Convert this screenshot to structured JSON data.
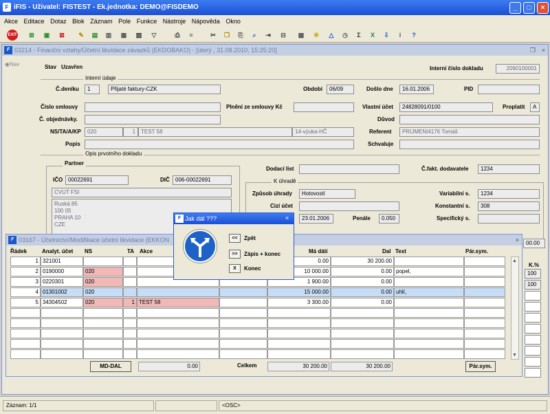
{
  "app": {
    "title": "iFIS - Uživatel: FISTEST - Ek.jednotka: DEMO@FISDEMO"
  },
  "menu": [
    "Akce",
    "Editace",
    "Dotaz",
    "Blok",
    "Záznam",
    "Pole",
    "Funkce",
    "Nástroje",
    "Nápověda",
    "Okno"
  ],
  "toolbar": {
    "exit_label": "EXIT"
  },
  "form1": {
    "title": "03214 - Finanční vztahy/Účetní likvidace závazků (EKDOBAKO) - [úterý , 31.08.2010, 15:25:20]",
    "nav": "Nav",
    "stav_label": "Stav",
    "stav_value": "Uzavřen",
    "interni_cislo_label": "Interní číslo dokladu",
    "interni_cislo_value": "2090100001",
    "interni_udaje_group": "Interní údaje",
    "c_deniku_label": "Č.deníku",
    "c_deniku_value": "1",
    "c_deniku_name": "Přijaté faktury-CZK",
    "obdobi_label": "Období",
    "obdobi_value": "06/09",
    "doslo_label": "Došlo dne",
    "doslo_value": "16.01.2006",
    "pid_label": "PID",
    "pid_value": "",
    "cislo_smlouvy_label": "Číslo smlouvy",
    "cislo_smlouvy_value": "",
    "plneni_label": "Plnění ze smlouvy Kč",
    "plneni_value": "",
    "vlastni_ucet_label": "Vlastní účet",
    "vlastni_ucet_value": "24828091/0100",
    "proplatit_label": "Proplatit",
    "proplatit_value": "A",
    "c_objednavky_label": "Č. objednávky.",
    "c_objednavky_value": "",
    "duvod_label": "Důvod",
    "duvod_value": "",
    "ns_label": "NS/TA/A/KP",
    "ns_value": "020",
    "ta_value": "1",
    "a_value": "TEST 58",
    "kp_value": "14-výuka-HČ",
    "referent_label": "Referent",
    "referent_value": "PRIJMENI4176 Tomáš",
    "popis_label": "Popis",
    "popis_value": "",
    "schvaluje_label": "Schvaluje",
    "schvaluje_value": "",
    "opis_group": "Opis prvotního dokladu",
    "partner_group": "Partner",
    "ico_label": "IČO",
    "ico_value": "00022691",
    "dic_label": "DIČ",
    "dic_value": "006-00022691",
    "partner_name": "CVUT FSI",
    "address": [
      "Ruská  85",
      "100 05",
      "PRAHA 10",
      "CZE"
    ],
    "dodaci_list_label": "Dodací list",
    "dodaci_list_value": "",
    "c_fakt_label": "Č.fakt. dodavatele",
    "c_fakt_value": "1234",
    "k_uhrade_group": "K úhradě",
    "zpusob_label": "Způsob úhrady",
    "zpusob_value": "Hotovostí",
    "variabilni_label": "Variabilní s.",
    "variabilni_value": "1234",
    "cizi_ucet_label": "Cizí účet",
    "cizi_ucet_value": "",
    "konstantni_label": "Konstantní s.",
    "konstantni_value": "308",
    "datum_value": "23.01.2006",
    "penale_label": "Penále",
    "penale_value": "0.050",
    "specificky_label": "Specifický s.",
    "specificky_value": "",
    "side_value": "00.00",
    "kpct_label": "K.%",
    "kpct_values": [
      "100",
      "100"
    ]
  },
  "form2": {
    "title": "03167 - Účetnictví/Modifikace účetní likvidace (EKKON",
    "headers": {
      "radek": "Řádek",
      "analyt": "Analyt. účet",
      "ns": "NS",
      "ta": "TA",
      "akce": "Akce",
      "ma_dati": "Má dáti",
      "dal": "Dal",
      "text": "Text",
      "par_sym": "Pár.sym."
    },
    "rows": [
      {
        "radek": "1",
        "ucet": "321001",
        "ns": "",
        "ta": "",
        "akce": "",
        "ma_dati": "0.00",
        "dal": "30 200.00",
        "text": "",
        "par": ""
      },
      {
        "radek": "2",
        "ucet": "0190000",
        "ns": "020",
        "ta": "",
        "akce": "",
        "ma_dati": "10 000.00",
        "dal": "0.00",
        "text": "popel,",
        "par": ""
      },
      {
        "radek": "3",
        "ucet": "0220301",
        "ns": "020",
        "ta": "",
        "akce": "",
        "ma_dati": "1 900.00",
        "dal": "0.00",
        "text": "",
        "par": ""
      },
      {
        "radek": "4",
        "ucet": "01301002",
        "ns": "020",
        "ta": "",
        "akce": "",
        "ma_dati": "15 000.00",
        "dal": "0.00",
        "text": "uhlí,",
        "par": ""
      },
      {
        "radek": "5",
        "ucet": "34304502",
        "ns": "020",
        "ta": "1",
        "akce": "TEST 58",
        "ma_dati": "3 300.00",
        "dal": "0.00",
        "text": "",
        "par": ""
      }
    ],
    "md_dal_label": "MD-DAL",
    "md_dal_value": "0.00",
    "celkem_label": "Celkem",
    "celkem_ma": "30 200.00",
    "celkem_dal": "30 200.00",
    "par_sym_button": "Pár.sym."
  },
  "dialog": {
    "title": "Jak dál ???",
    "buttons": [
      {
        "key": "<<",
        "label": "Zpět"
      },
      {
        "key": ">>",
        "label": "Zápis + konec"
      },
      {
        "key": "X",
        "label": "Konec"
      }
    ]
  },
  "status": {
    "zaznam": "Záznam: 1/1",
    "osc": "<OSC>"
  },
  "colors": {
    "pink": "#f2b8b8",
    "blue": "#c6dcf7",
    "title": "#1b4fd6"
  }
}
